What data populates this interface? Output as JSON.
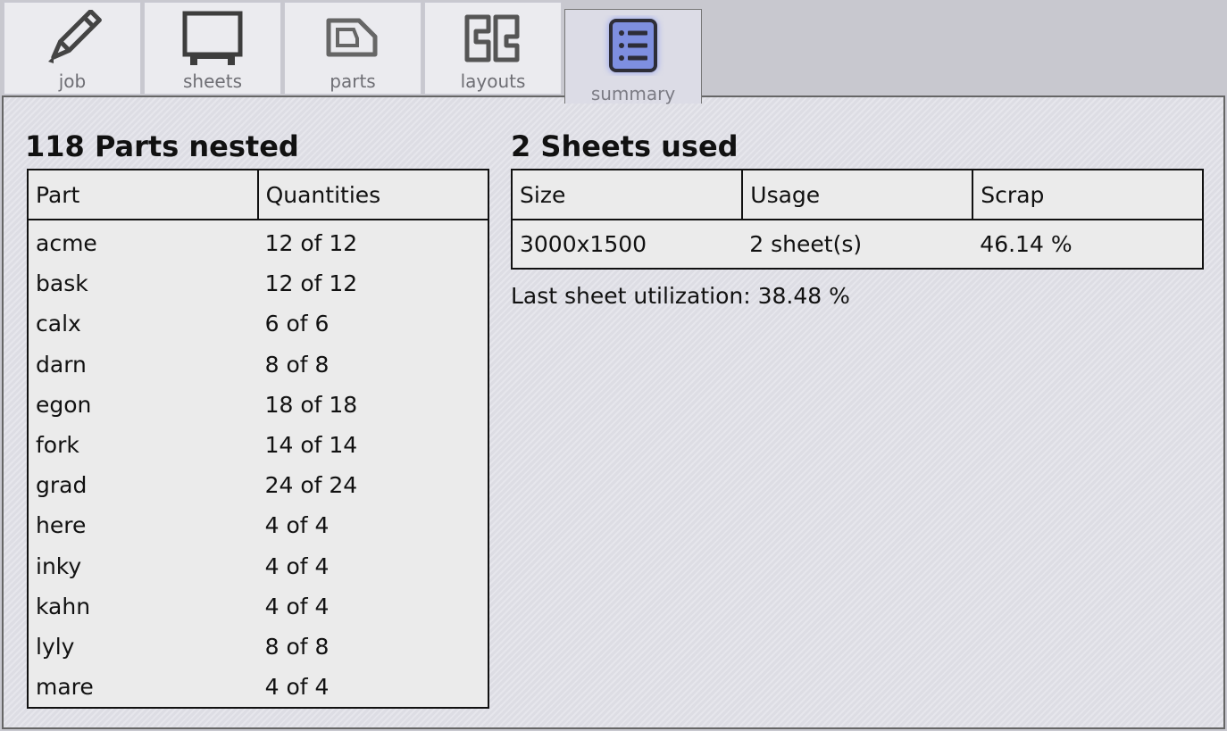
{
  "tabs": [
    {
      "label": "job",
      "icon": "pencil-icon"
    },
    {
      "label": "sheets",
      "icon": "sheet-icon"
    },
    {
      "label": "parts",
      "icon": "part-icon"
    },
    {
      "label": "layouts",
      "icon": "layout-icon"
    },
    {
      "label": "summary",
      "icon": "list-icon",
      "active": true
    }
  ],
  "summary": {
    "parts_heading": "118 Parts nested",
    "parts_columns": [
      "Part",
      "Quantities"
    ],
    "parts": [
      {
        "name": "acme",
        "qty": "12 of 12"
      },
      {
        "name": "bask",
        "qty": "12 of 12"
      },
      {
        "name": "calx",
        "qty": "6 of 6"
      },
      {
        "name": "darn",
        "qty": "8 of 8"
      },
      {
        "name": "egon",
        "qty": "18 of 18"
      },
      {
        "name": "fork",
        "qty": "14 of 14"
      },
      {
        "name": "grad",
        "qty": "24 of 24"
      },
      {
        "name": "here",
        "qty": "4 of 4"
      },
      {
        "name": "inky",
        "qty": "4 of 4"
      },
      {
        "name": "kahn",
        "qty": "4 of 4"
      },
      {
        "name": "lyly",
        "qty": "8 of 8"
      },
      {
        "name": "mare",
        "qty": "4 of 4"
      }
    ],
    "sheets_heading": "2 Sheets used",
    "sheets_columns": [
      "Size",
      "Usage",
      "Scrap"
    ],
    "sheets": [
      {
        "size": "3000x1500",
        "usage": "2 sheet(s)",
        "scrap": "46.14 %"
      }
    ],
    "last_sheet_utilization": "Last sheet utilization: 38.48 %"
  },
  "colors": {
    "background": "#c8c8cf",
    "tab": "#ebebef",
    "active_tab": "#dcdce6",
    "panel": "#dddde4",
    "table": "#ebebeb",
    "accent": "#7e8fe0"
  }
}
